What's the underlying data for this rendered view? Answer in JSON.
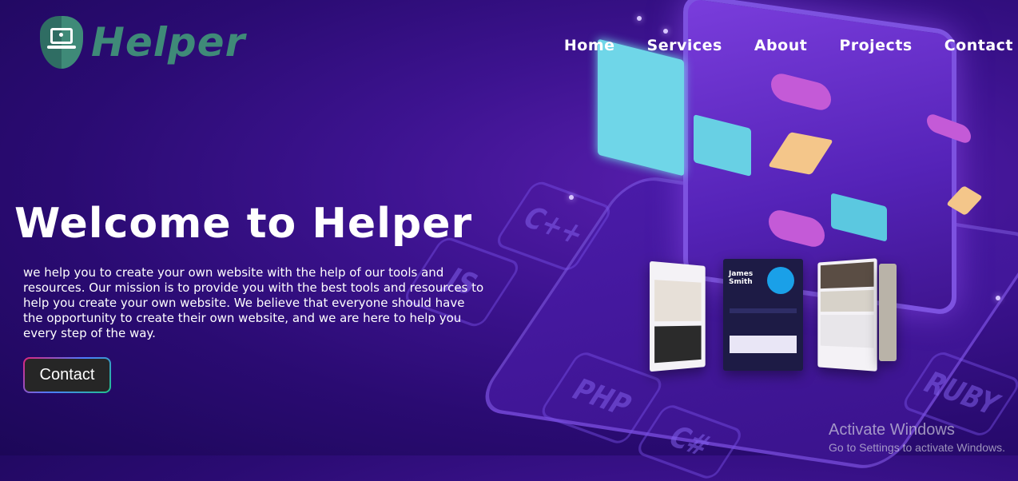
{
  "brand": {
    "name": "Helper"
  },
  "nav": {
    "items": [
      {
        "label": "Home"
      },
      {
        "label": "Services"
      },
      {
        "label": "About"
      },
      {
        "label": "Projects"
      },
      {
        "label": "Contact"
      }
    ]
  },
  "hero": {
    "title": "Welcome to Helper",
    "text": "we help you to create your own website with the help of our tools and resources. Our mission is to provide you with the best tools and resources to help you create your own website. We believe that everyone should have the opportunity to create their own website, and we are here to help you every step of the way.",
    "button_label": "Contact"
  },
  "background_tiles": [
    "C++",
    "JS",
    "PHP",
    "C#",
    "RUBY"
  ],
  "showcase": {
    "card_name": "James\nSmith"
  },
  "watermark": {
    "title": "Activate Windows",
    "subtitle": "Go to Settings to activate Windows."
  },
  "colors": {
    "background": "#2a0b72",
    "brand_green": "#3f8a78",
    "button_bg": "#262626"
  }
}
